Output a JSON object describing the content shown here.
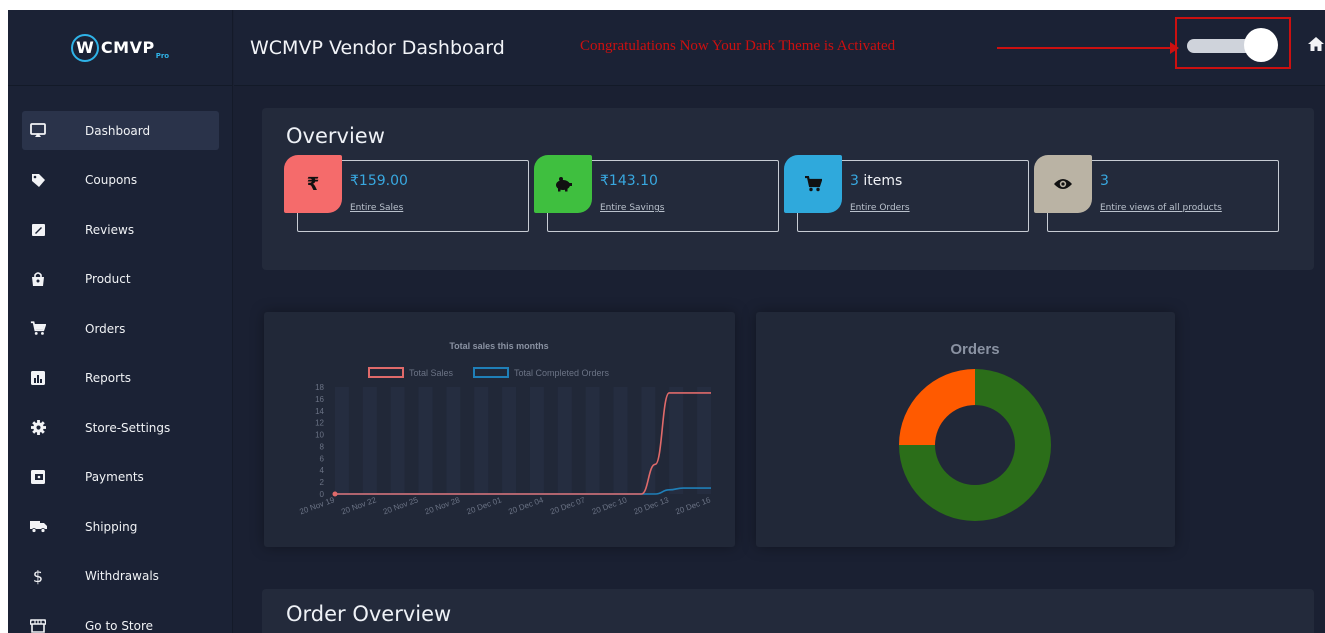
{
  "app": {
    "logo_text": "CMVP",
    "logo_badge": "W",
    "logo_sub": "Pro",
    "page_title": "WCMVP Vendor Dashboard",
    "notice": "Congratulations Now Your Dark Theme is Activated"
  },
  "theme_toggle": {
    "state": "on"
  },
  "sidebar": {
    "items": [
      {
        "label": "Dashboard",
        "icon": "monitor-icon",
        "active": true
      },
      {
        "label": "Coupons",
        "icon": "tag-icon"
      },
      {
        "label": "Reviews",
        "icon": "edit-icon"
      },
      {
        "label": "Product",
        "icon": "shopping-bag-icon"
      },
      {
        "label": "Orders",
        "icon": "cart-icon"
      },
      {
        "label": "Reports",
        "icon": "bar-chart-icon"
      },
      {
        "label": "Store-Settings",
        "icon": "gear-icon"
      },
      {
        "label": "Payments",
        "icon": "wallet-icon"
      },
      {
        "label": "Shipping",
        "icon": "truck-icon"
      },
      {
        "label": "Withdrawals",
        "icon": "dollar-icon"
      },
      {
        "label": "Go to Store",
        "icon": "store-icon"
      }
    ]
  },
  "overview": {
    "title": "Overview",
    "stats": [
      {
        "symbol": "₹",
        "value": "₹159.00",
        "link": "Entire Sales",
        "color": "#f56b6b",
        "icon": "rupee-icon"
      },
      {
        "symbol": "",
        "value": "₹143.10",
        "link": "Entire Savings",
        "color": "#3fbf3f",
        "icon": "piggy-bank-icon"
      },
      {
        "symbol": "",
        "value": "3",
        "suffix": " items",
        "link": "Entire Orders",
        "color": "#2fa9dc",
        "icon": "cart-icon"
      },
      {
        "symbol": "",
        "value": "3",
        "link": "Entire views of all products",
        "color": "#bab3a4",
        "icon": "eye-icon"
      }
    ]
  },
  "order_overview": {
    "title": "Order Overview"
  },
  "charts": {
    "sales": {
      "title": "Total sales this months",
      "legend_sales": "Total Sales",
      "legend_completed": "Total Completed Orders",
      "sales_color": "#e06a6a",
      "completed_color": "#1f7fb8"
    },
    "orders": {
      "title": "Orders"
    }
  },
  "chart_data": [
    {
      "type": "line",
      "title": "Total sales this months",
      "x": [
        "20 Nov 19",
        "20 Nov 20",
        "20 Nov 21",
        "20 Nov 22",
        "20 Nov 23",
        "20 Nov 24",
        "20 Nov 25",
        "20 Nov 26",
        "20 Nov 27",
        "20 Nov 28",
        "20 Nov 29",
        "20 Nov 30",
        "20 Dec 01",
        "20 Dec 02",
        "20 Dec 03",
        "20 Dec 04",
        "20 Dec 05",
        "20 Dec 06",
        "20 Dec 07",
        "20 Dec 08",
        "20 Dec 09",
        "20 Dec 10",
        "20 Dec 11",
        "20 Dec 12",
        "20 Dec 13",
        "20 Dec 14",
        "20 Dec 15",
        "20 Dec 16"
      ],
      "tick_labels": [
        "20 Nov 19",
        "20 Nov 22",
        "20 Nov 25",
        "20 Nov 28",
        "20 Dec 01",
        "20 Dec 04",
        "20 Dec 07",
        "20 Dec 10",
        "20 Dec 13",
        "20 Dec 16"
      ],
      "yticks": [
        0,
        2,
        4,
        6,
        8,
        10,
        12,
        14,
        16,
        18
      ],
      "ylim": [
        0,
        18
      ],
      "series": [
        {
          "name": "Total Sales",
          "values": [
            0,
            0,
            0,
            0,
            0,
            0,
            0,
            0,
            0,
            0,
            0,
            0,
            0,
            0,
            0,
            0,
            0,
            0,
            0,
            0,
            0,
            0,
            0,
            5,
            17,
            17,
            17,
            17
          ]
        },
        {
          "name": "Total Completed Orders",
          "values": [
            0,
            0,
            0,
            0,
            0,
            0,
            0,
            0,
            0,
            0,
            0,
            0,
            0,
            0,
            0,
            0,
            0,
            0,
            0,
            0,
            0,
            0,
            0,
            0,
            0.7,
            1,
            1,
            1
          ]
        }
      ],
      "legend_position": "top"
    },
    {
      "type": "pie",
      "title": "Orders",
      "donut": true,
      "slices": [
        {
          "value": 75,
          "color": "#2b6e19"
        },
        {
          "value": 25,
          "color": "#ff5a00"
        }
      ]
    }
  ]
}
